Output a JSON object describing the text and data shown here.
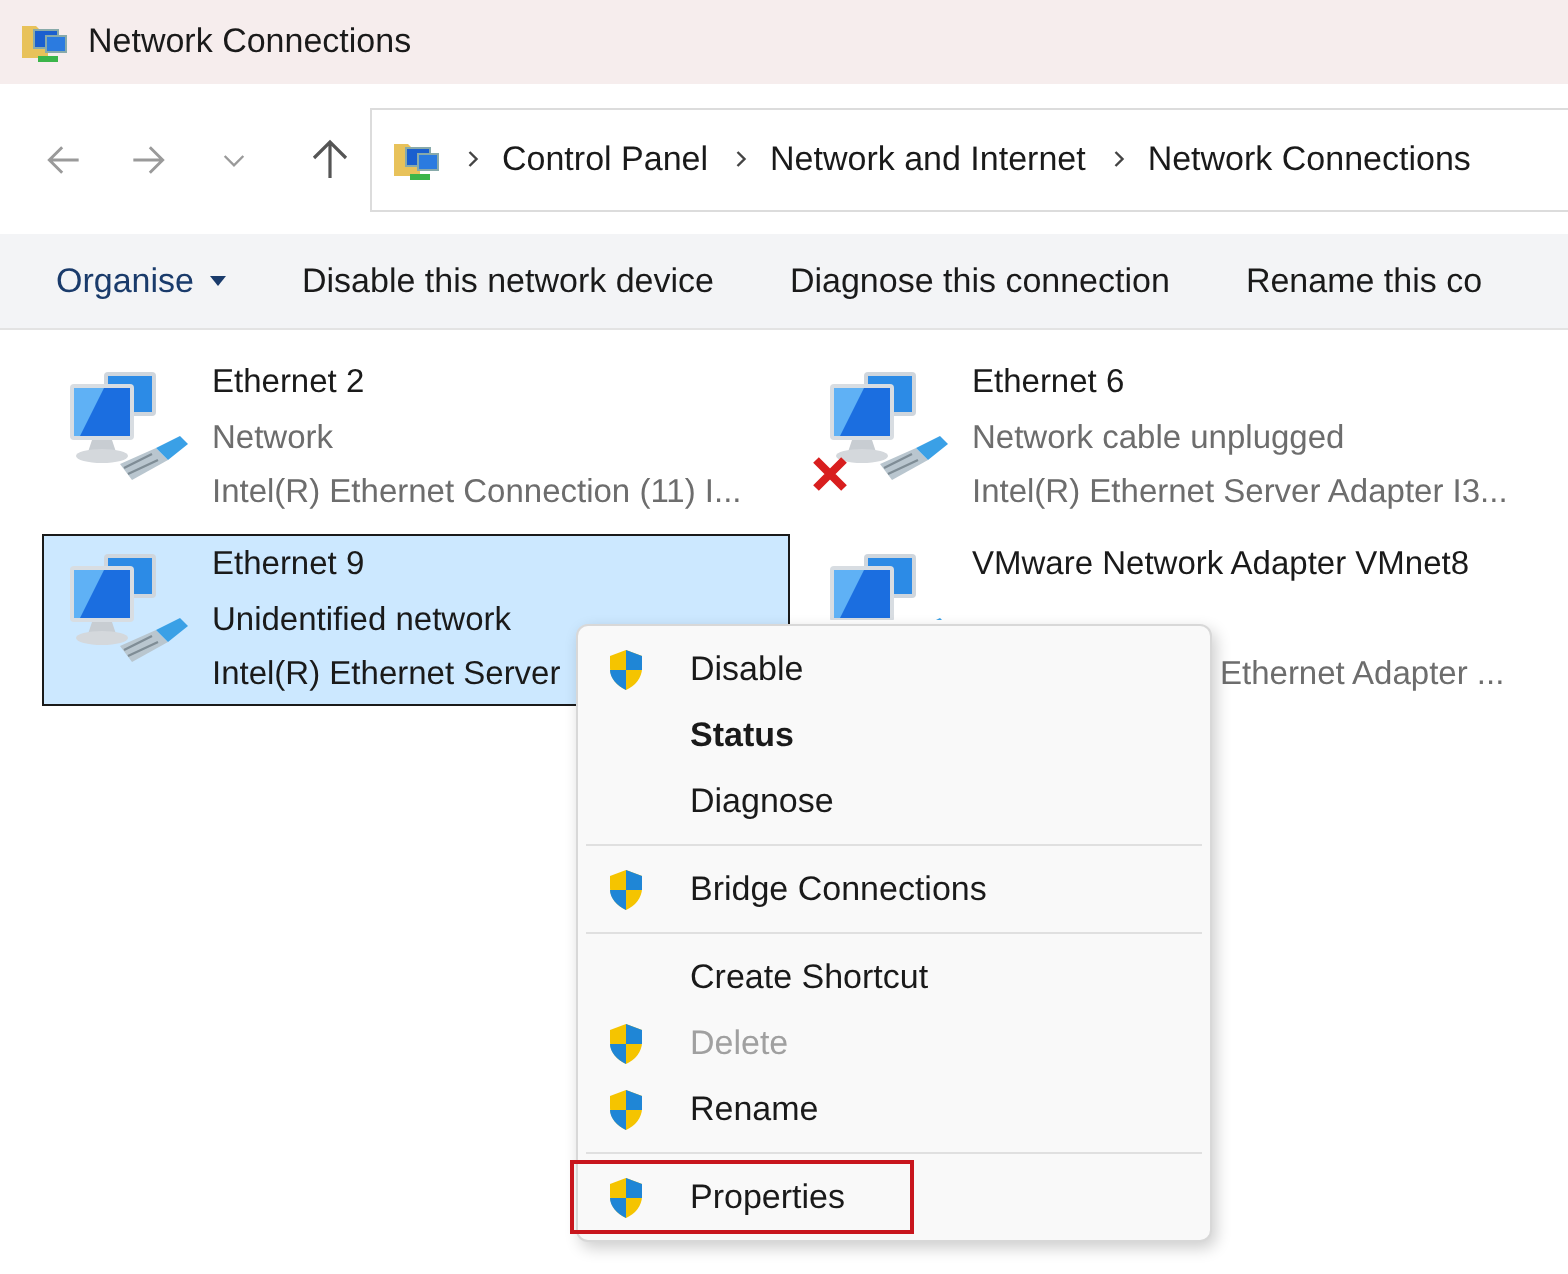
{
  "window": {
    "title": "Network Connections"
  },
  "address_bar": {
    "crumbs": [
      "Control Panel",
      "Network and Internet",
      "Network Connections"
    ]
  },
  "toolbar": {
    "items": [
      {
        "label": "Organise",
        "kind": "dropdown"
      },
      {
        "label": "Disable this network device",
        "kind": "button"
      },
      {
        "label": "Diagnose this connection",
        "kind": "button"
      },
      {
        "label": "Rename this co",
        "kind": "button"
      }
    ]
  },
  "adapters": [
    {
      "name": "Ethernet 2",
      "status": "Network",
      "description": "Intel(R) Ethernet Connection (11) I...",
      "unplugged": false,
      "selected": false,
      "kind": "full"
    },
    {
      "name": "Ethernet 6",
      "status": "Network cable unplugged",
      "description": "Intel(R) Ethernet Server Adapter I3...",
      "unplugged": true,
      "selected": false,
      "kind": "full"
    },
    {
      "name": "Ethernet 9",
      "status": "Unidentified network",
      "description": "Intel(R) Ethernet Server",
      "unplugged": false,
      "selected": true,
      "kind": "full"
    },
    {
      "name": "VMware Network Adapter VMnet8",
      "description": "Ethernet Adapter ...",
      "selected": false,
      "kind": "behind_menu"
    }
  ],
  "context_menu": {
    "items": [
      {
        "kind": "item",
        "label": "Disable",
        "shield": true,
        "default": false,
        "disabled": false,
        "highlighted": false
      },
      {
        "kind": "item",
        "label": "Status",
        "shield": false,
        "default": true,
        "disabled": false,
        "highlighted": false
      },
      {
        "kind": "item",
        "label": "Diagnose",
        "shield": false,
        "default": false,
        "disabled": false,
        "highlighted": false
      },
      {
        "kind": "separator"
      },
      {
        "kind": "item",
        "label": "Bridge Connections",
        "shield": true,
        "default": false,
        "disabled": false,
        "highlighted": false
      },
      {
        "kind": "separator"
      },
      {
        "kind": "item",
        "label": "Create Shortcut",
        "shield": false,
        "default": false,
        "disabled": false,
        "highlighted": false
      },
      {
        "kind": "item",
        "label": "Delete",
        "shield": true,
        "default": false,
        "disabled": true,
        "highlighted": false
      },
      {
        "kind": "item",
        "label": "Rename",
        "shield": true,
        "default": false,
        "disabled": false,
        "highlighted": false
      },
      {
        "kind": "separator"
      },
      {
        "kind": "item",
        "label": "Properties",
        "shield": true,
        "default": false,
        "disabled": false,
        "highlighted": true
      }
    ]
  }
}
